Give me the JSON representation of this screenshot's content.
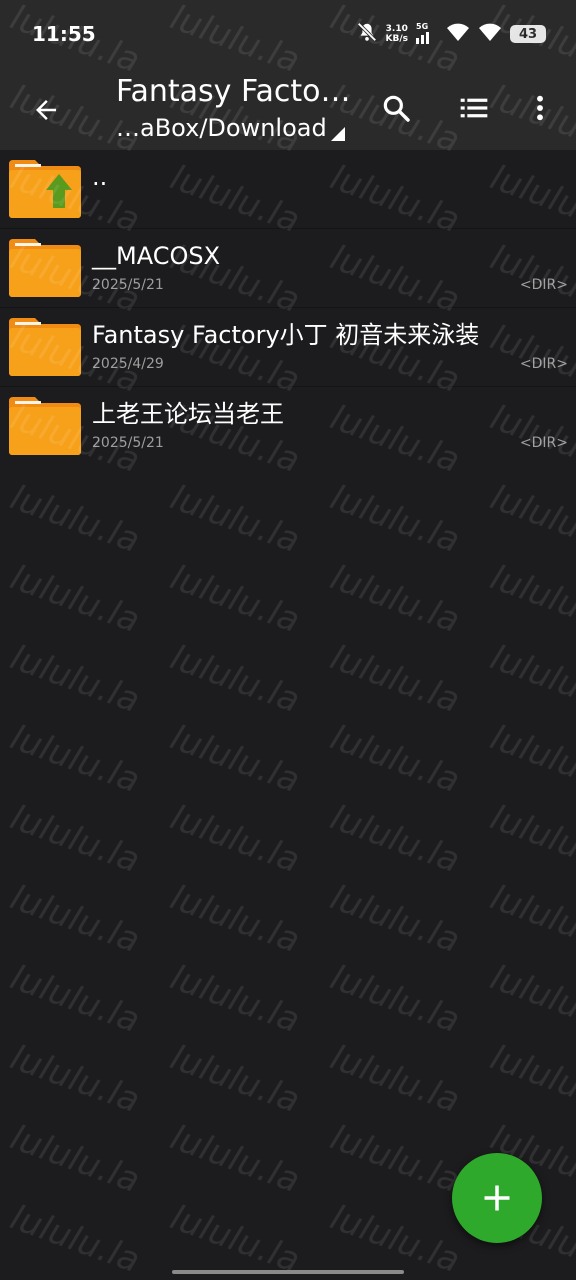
{
  "status_bar": {
    "time": "11:55",
    "net_speed_value": "3.10",
    "net_speed_unit": "KB/s",
    "network": "5G",
    "battery": "43",
    "icons": [
      "bell-off-icon",
      "signal-icon",
      "wifi-icon",
      "wifi-icon",
      "battery-icon"
    ]
  },
  "app_bar": {
    "title": "Fantasy Facto…",
    "path": "…aBox/Download",
    "icons": [
      "back-arrow-icon",
      "search-icon",
      "list-view-icon",
      "more-vert-icon"
    ]
  },
  "files": [
    {
      "name": "..",
      "date": "",
      "type": "",
      "icon": "folder-up-icon"
    },
    {
      "name": "__MACOSX",
      "date": "2025/5/21",
      "type": "<DIR>",
      "icon": "folder-icon"
    },
    {
      "name": "Fantasy Factory小丁 初音未来泳装",
      "date": "2025/4/29",
      "type": "<DIR>",
      "icon": "folder-icon"
    },
    {
      "name": "上老王论坛当老王",
      "date": "2025/5/21",
      "type": "<DIR>",
      "icon": "folder-icon"
    }
  ],
  "watermark": "lululu.la",
  "colors": {
    "background": "#1c1c1e",
    "bar": "#2a2a2a",
    "folder": "#f7a11a",
    "folder_tab": "#f08c14",
    "fab": "#2fa92b",
    "up_arrow": "#5a9a1e"
  },
  "fab": {
    "icon": "plus-icon"
  }
}
